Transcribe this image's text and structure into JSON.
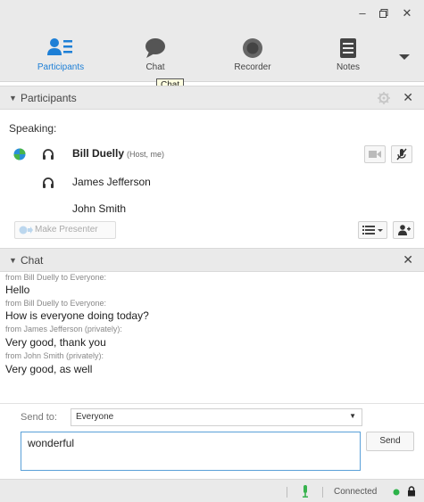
{
  "colors": {
    "accent": "#1d7fd6",
    "connected": "#2db34a",
    "mic": "#37b24d"
  },
  "tabs": [
    {
      "label": "Participants",
      "icon": "participants-icon",
      "active": true
    },
    {
      "label": "Chat",
      "icon": "chat-icon",
      "active": false
    },
    {
      "label": "Recorder",
      "icon": "recorder-icon",
      "active": false
    },
    {
      "label": "Notes",
      "icon": "notes-icon",
      "active": false
    }
  ],
  "tooltip": "Chat",
  "participants_panel": {
    "title": "Participants",
    "speaking_label": "Speaking:",
    "people": [
      {
        "name": "Bill Duelly",
        "sub": "(Host, me)"
      },
      {
        "name": "James Jefferson",
        "sub": ""
      },
      {
        "name": "John Smith",
        "sub": ""
      }
    ],
    "make_presenter_label": "Make Presenter"
  },
  "chat_panel": {
    "title": "Chat",
    "messages": [
      {
        "from": "from Bill Duelly to Everyone:",
        "text": "Hello"
      },
      {
        "from": "from Bill Duelly to Everyone:",
        "text": "How is everyone doing today?"
      },
      {
        "from": "from James Jefferson (privately):",
        "text": "Very good, thank you"
      },
      {
        "from": "from John Smith (privately):",
        "text": "Very good, as well"
      }
    ],
    "send_to_label": "Send to:",
    "send_to_value": "Everyone",
    "input_value": "wonderful",
    "send_label": "Send"
  },
  "status": {
    "connection": "Connected"
  }
}
